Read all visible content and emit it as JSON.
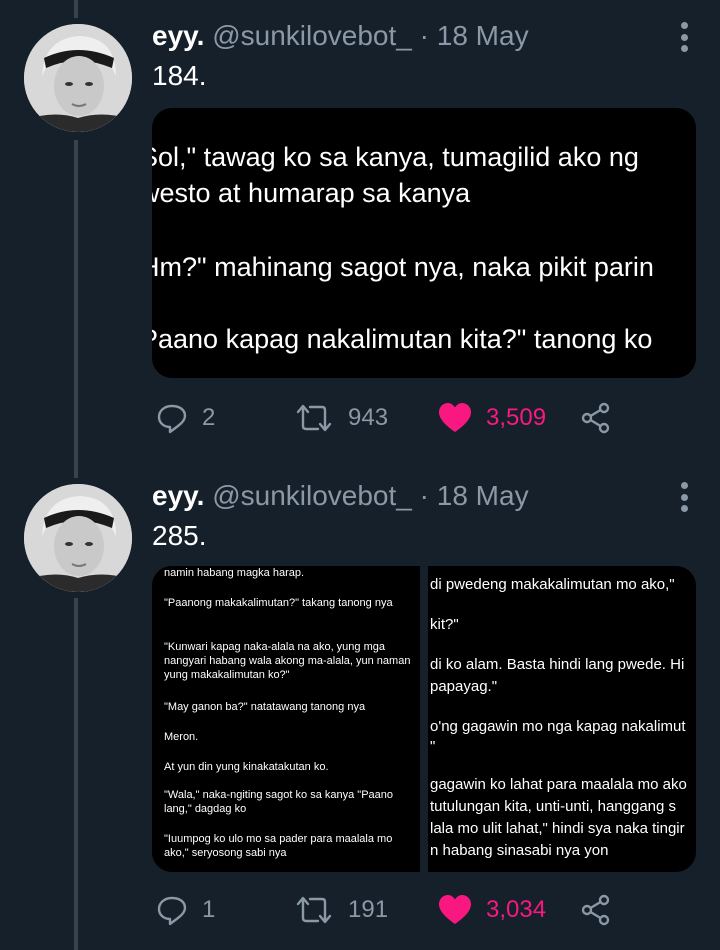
{
  "tweets": [
    {
      "name": "eyy.",
      "handle": "@sunkilovebot_",
      "separator": "·",
      "date": "18 May",
      "text": "184.",
      "media_lines": [
        "Sol,\" tawag ko sa kanya, tumagilid ako ng",
        "westo at humarap sa kanya",
        "Hm?\" mahinang sagot nya, naka pikit parin",
        "Paano kapag nakalimutan kita?\" tanong ko"
      ],
      "replies": "2",
      "retweets": "943",
      "likes": "3,509",
      "liked": true
    },
    {
      "name": "eyy.",
      "handle": "@sunkilovebot_",
      "separator": "·",
      "date": "18 May",
      "text": "285.",
      "media_left_lines": [
        "namin habang magka harap.",
        "\"Paanong makakalimutan?\" takang tanong nya",
        "\"Kunwari kapag naka-alala na ako, yung mga nangyari habang wala akong ma-alala, yun naman yung makakalimutan ko?\"",
        "\"May ganon ba?\" natatawang tanong nya",
        "Meron.",
        "At yun din yung kinakatakutan ko.",
        "\"Wala,\" naka-ngiting sagot ko sa kanya \"Paano lang,\" dagdag ko",
        "\"Iuumpog ko ulo mo sa pader para maalala mo ako,\" seryosong sabi nya"
      ],
      "media_right_lines": [
        "di pwedeng makakalimutan mo ako,\"",
        "kit?\"",
        "di ko alam. Basta hindi lang pwede. Hi",
        "papayag.\"",
        "o'ng gagawin mo nga kapag nakalimut",
        "\"",
        "gagawin ko lahat para maalala mo ako",
        "tutulungan kita, unti-unti, hanggang s",
        "lala mo ulit lahat,\" hindi sya naka tingir",
        "n habang sinasabi nya yon"
      ],
      "replies": "1",
      "retweets": "191",
      "likes": "3,034",
      "liked": true
    }
  ],
  "colors": {
    "background": "#15202b",
    "secondary_text": "#8b98a5",
    "like": "#f91880",
    "thread_line": "#38444d"
  },
  "icons": [
    "more-icon",
    "reply-icon",
    "retweet-icon",
    "heart-icon",
    "share-icon"
  ]
}
